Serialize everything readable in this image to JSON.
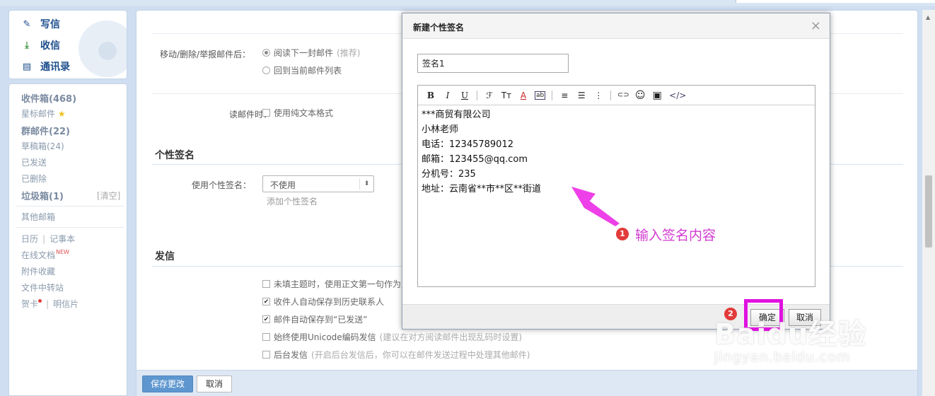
{
  "sidebar": {
    "quick": {
      "compose": "写信",
      "inbox": "收信",
      "contacts": "通讯录"
    },
    "folders": {
      "inbox": "收件箱(468)",
      "starred": "星标邮件",
      "group": "群邮件(22)",
      "drafts": "草稿箱(24)",
      "sent": "已发送",
      "deleted": "已删除",
      "spam": "垃圾箱(1)",
      "clear": "[清空]",
      "other": "其他邮箱"
    },
    "tools": {
      "calendar": "日历",
      "notes": "记事本",
      "docs": "在线文档",
      "docs_badge": "NEW",
      "attachments": "附件收藏",
      "transfer": "文件中转站",
      "cards": "贺卡",
      "postcard": "明信片"
    }
  },
  "settings": {
    "after_move_label": "移动/删除/举报邮件后：",
    "after_move_opt1": "阅读下一封邮件",
    "after_move_opt1_hint": "(推荐)",
    "after_move_opt2": "回到当前邮件列表",
    "read_label": "读邮件时：",
    "read_opt": "使用纯文本格式",
    "signature_section": "个性签名",
    "signature_label": "使用个性签名：",
    "signature_select": "不使用",
    "add_signature": "添加个性签名",
    "send_section": "发信",
    "send_opts": [
      {
        "label": "未填主题时，使用正文第一句作为主",
        "hint": "",
        "checked": false
      },
      {
        "label": "收件人自动保存到历史联系人",
        "hint": "",
        "checked": true
      },
      {
        "label": "邮件自动保存到“已发送”",
        "hint": "",
        "checked": true
      },
      {
        "label": "始终使用Unicode编码发信",
        "hint": "(建议在对方阅读邮件出现乱码时设置)",
        "checked": false
      },
      {
        "label": "后台发信",
        "hint": "(开启后台发信后，你可以在邮件发送过程中处理其他邮件)",
        "checked": false
      }
    ],
    "save_button": "保存更改",
    "cancel_button": "取消"
  },
  "dialog": {
    "title": "新建个性签名",
    "close": "×",
    "name_value": "签名1",
    "toolbar": {
      "bold": "B",
      "italic": "I",
      "underline": "U",
      "font": "ℱ",
      "size": "Tт",
      "color": "A",
      "bg": "ab",
      "align": "≡",
      "list": "☰",
      "indent": "⋮",
      "link": "⊂⊃",
      "emoji": "☺",
      "image": "▣",
      "html": "</>"
    },
    "content_lines": [
      "***商贸有限公司",
      "小林老师",
      "电话：12345789012",
      "邮箱：123455@qq.com",
      "分机号：235",
      "地址：云南省**市**区**街道"
    ],
    "ok": "确定",
    "cancel": "取消"
  },
  "annotations": {
    "step1_num": "1",
    "step1_text": "输入签名内容",
    "step2_num": "2",
    "highlight_color": "#e010e0"
  },
  "watermark": {
    "line1": "Baidu经验",
    "line2": "jingyan.baidu.com"
  }
}
